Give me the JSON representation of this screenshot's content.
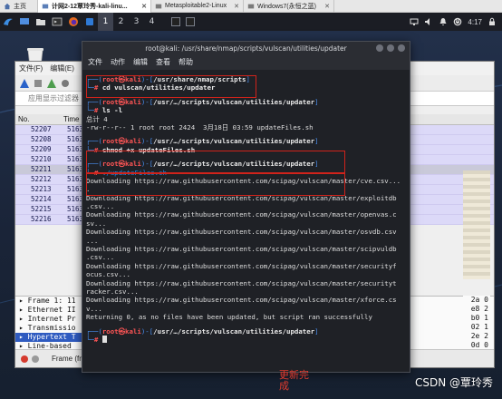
{
  "vm_tabs": [
    {
      "label": "主页",
      "active": false
    },
    {
      "label": "计网2-12覃玲秀-kali-linu...",
      "active": true
    },
    {
      "label": "Metasploitable2-Linux",
      "active": false
    },
    {
      "label": "Windows7(永恒之蓝)",
      "active": false
    }
  ],
  "kali_panel": {
    "workspaces": [
      "1",
      "2",
      "3",
      "4"
    ],
    "active_workspace": "1",
    "clock": "4:17"
  },
  "wireshark": {
    "menu": [
      "文件(F)",
      "编辑(E)"
    ],
    "filter_placeholder": "应用显示过滤器",
    "columns": [
      "No.",
      "Time"
    ],
    "rows": [
      {
        "no": "52207",
        "time": "5163"
      },
      {
        "no": "52208",
        "time": "5163"
      },
      {
        "no": "52209",
        "time": "5163"
      },
      {
        "no": "52210",
        "time": "5163"
      },
      {
        "no": "52211",
        "time": "5163"
      },
      {
        "no": "52212",
        "time": "5163"
      },
      {
        "no": "52213",
        "time": "5163"
      },
      {
        "no": "52214",
        "time": "5163"
      },
      {
        "no": "52215",
        "time": "5163"
      },
      {
        "no": "52216",
        "time": "5163"
      }
    ],
    "selected_row_index": 4,
    "details": [
      "Frame 1: 11",
      "Ethernet II",
      "Internet Pr",
      "Transmissio",
      "Hypertext T",
      "Line-based"
    ],
    "bytes": [
      "2a 0",
      "e8 2",
      "b0 1",
      "02 1",
      "2e 2",
      "0d 0"
    ],
    "status": "Frame (fr"
  },
  "terminal": {
    "title": "root@kali: /usr/share/nmap/scripts/vulscan/utilities/updater",
    "menu": [
      "文件",
      "动作",
      "编辑",
      "查看",
      "帮助"
    ],
    "blocks": [
      {
        "user": "root㉿kali",
        "path": "/usr/share/nmap/scripts",
        "cmd": "cd vulscan/utilities/updater",
        "output": []
      },
      {
        "user": "root㉿kali",
        "path": "/usr/…/scripts/vulscan/utilities/updater",
        "cmd": "ls -l",
        "output": [
          "总计 4",
          "-rw-r--r-- 1 root root 2424  3月18日 03:59 updateFiles.sh"
        ]
      },
      {
        "user": "root㉿kali",
        "path": "/usr/…/scripts/vulscan/utilities/updater",
        "cmd": "chmod +x updateFiles.sh",
        "output": []
      },
      {
        "user": "root㉿kali",
        "path": "/usr/…/scripts/vulscan/utilities/updater",
        "cmd": "./updateFiles.sh",
        "output": [
          "Downloading https://raw.githubusercontent.com/scipag/vulscan/master/cve.csv...",
          ".",
          "Downloading https://raw.githubusercontent.com/scipag/vulscan/master/exploitdb",
          ".csv...",
          "Downloading https://raw.githubusercontent.com/scipag/vulscan/master/openvas.c",
          "sv...",
          "Downloading https://raw.githubusercontent.com/scipag/vulscan/master/osvdb.csv",
          "...",
          "Downloading https://raw.githubusercontent.com/scipag/vulscan/master/scipvuldb",
          ".csv...",
          "Downloading https://raw.githubusercontent.com/scipag/vulscan/master/securityf",
          "ocus.csv...",
          "Downloading https://raw.githubusercontent.com/scipag/vulscan/master/securityt",
          "racker.csv...",
          "Downloading https://raw.githubusercontent.com/scipag/vulscan/master/xforce.cs",
          "v...",
          "Returning 0, as no files have been updated, but script ran successfully"
        ]
      },
      {
        "user": "root㉿kali",
        "path": "/usr/…/scripts/vulscan/utilities/updater",
        "cmd": "",
        "output": []
      }
    ]
  },
  "trash_label": "",
  "annotation_note": "更新完成",
  "watermark": "CSDN @覃玲秀",
  "colors": {
    "prompt_user": "#ff5555",
    "prompt_frame": "#4a8ff0",
    "highlight_box": "#d0231b"
  }
}
